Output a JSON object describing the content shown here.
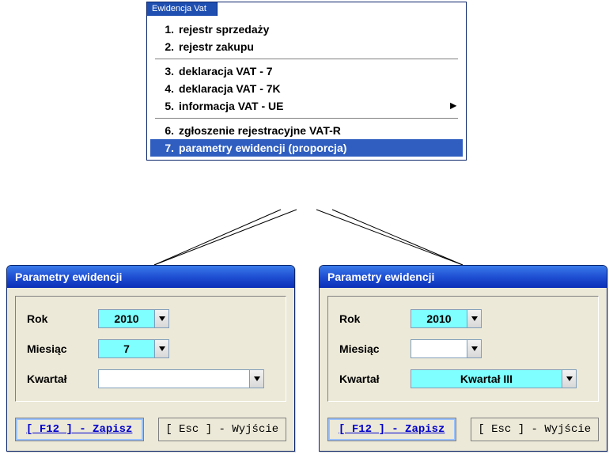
{
  "menu": {
    "title": "Ewidencja Vat",
    "items": [
      {
        "num": "1.",
        "label": "rejestr sprzedaży"
      },
      {
        "num": "2.",
        "label": "rejestr zakupu"
      },
      {
        "num": "3.",
        "label": "deklaracja VAT - 7"
      },
      {
        "num": "4.",
        "label": "deklaracja VAT - 7K"
      },
      {
        "num": "5.",
        "label": "informacja VAT - UE"
      },
      {
        "num": "6.",
        "label": "zgłoszenie rejestracyjne VAT-R"
      },
      {
        "num": "7.",
        "label": "parametry ewidencji (proporcja)"
      }
    ]
  },
  "dialog": {
    "title": "Parametry ewidencji",
    "labels": {
      "rok": "Rok",
      "miesiac": "Miesiąc",
      "kwartal": "Kwartał"
    },
    "buttons": {
      "save": "[ F12 ] - Zapisz",
      "exit": "[ Esc ] - Wyjście"
    }
  },
  "left": {
    "rok": "2010",
    "miesiac": "7",
    "kwartal": ""
  },
  "right": {
    "rok": "2010",
    "miesiac": "",
    "kwartal": "Kwartał III"
  }
}
